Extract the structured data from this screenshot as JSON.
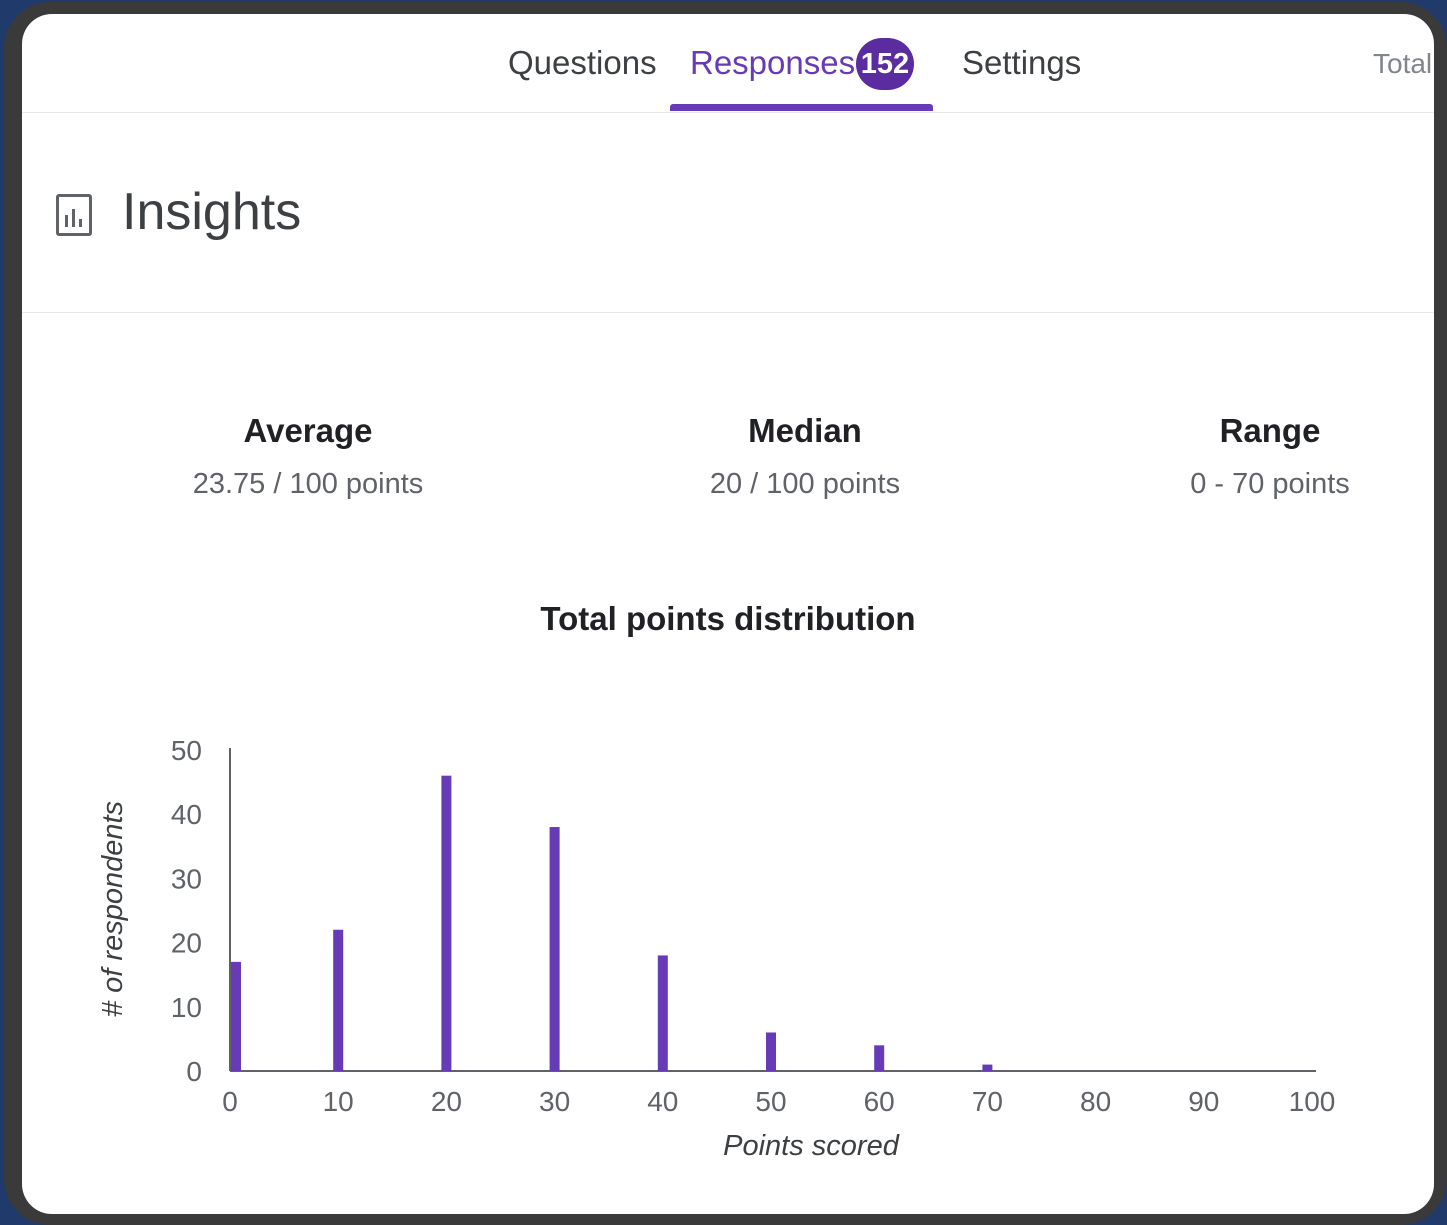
{
  "tabs": {
    "questions": "Questions",
    "responses": "Responses",
    "responses_count": "152",
    "settings": "Settings",
    "partial_right": "Total"
  },
  "insights": {
    "title": "Insights"
  },
  "stats": {
    "average": {
      "label": "Average",
      "value": "23.75 / 100 points"
    },
    "median": {
      "label": "Median",
      "value": "20 / 100 points"
    },
    "range": {
      "label": "Range",
      "value": "0 - 70 points"
    }
  },
  "colors": {
    "accent": "#673ab7",
    "bar": "#673ab7",
    "badge": "#5b2ca0"
  },
  "chart_data": {
    "type": "bar",
    "title": "Total points distribution",
    "xlabel": "Points scored",
    "ylabel": "# of respondents",
    "x": [
      0,
      10,
      20,
      30,
      40,
      50,
      60,
      70
    ],
    "values": [
      17,
      22,
      46,
      38,
      18,
      6,
      4,
      1
    ],
    "xlim": [
      0,
      100
    ],
    "ylim": [
      0,
      50
    ],
    "xticks": [
      "0",
      "10",
      "20",
      "30",
      "40",
      "50",
      "60",
      "70",
      "80",
      "90",
      "100"
    ],
    "yticks": [
      "0",
      "10",
      "20",
      "30",
      "40",
      "50"
    ],
    "grid": false
  }
}
